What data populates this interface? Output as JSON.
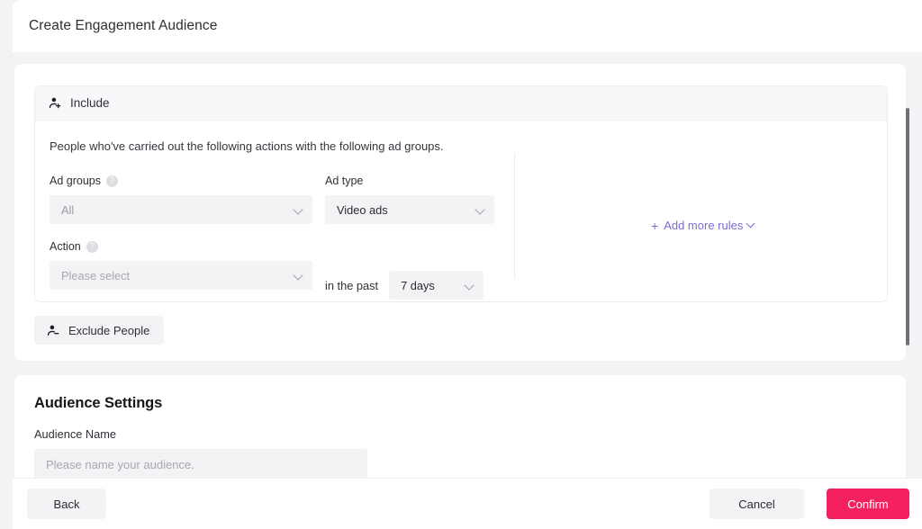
{
  "window": {
    "title": "Create Engagement Audience"
  },
  "include_panel": {
    "header_label": "Include",
    "header_icon": "person-add-icon",
    "description": "People who've carried out the following actions with the following ad groups.",
    "fields": {
      "ad_groups": {
        "label": "Ad groups",
        "help_icon": "question-mark-icon",
        "value": "All",
        "chevron_icon": "chevron-down-icon"
      },
      "ad_type": {
        "label": "Ad type",
        "value": "Video ads",
        "chevron_icon": "chevron-down-icon"
      },
      "action": {
        "label": "Action",
        "help_icon": "question-mark-icon",
        "placeholder": "Please select",
        "value": "Please select",
        "chevron_icon": "chevron-down-icon"
      },
      "time_window": {
        "label": "in the past",
        "value": "7 days",
        "chevron_icon": "chevron-down-icon"
      }
    },
    "add_more_rules": {
      "plus": "+",
      "label": "Add more rules",
      "chevron_icon": "chevron-down-icon",
      "color": "#7b6bd6"
    }
  },
  "exclude_button": {
    "label": "Exclude People",
    "icon": "person-remove-icon"
  },
  "audience_settings": {
    "title": "Audience Settings",
    "name_label": "Audience Name",
    "name_placeholder": "Please name your audience.",
    "name_value": ""
  },
  "footer": {
    "back_label": "Back",
    "cancel_label": "Cancel",
    "confirm_label": "Confirm",
    "confirm_color": "#f3225e"
  },
  "scrollbar": {
    "name": "vertical-scrollbar"
  }
}
